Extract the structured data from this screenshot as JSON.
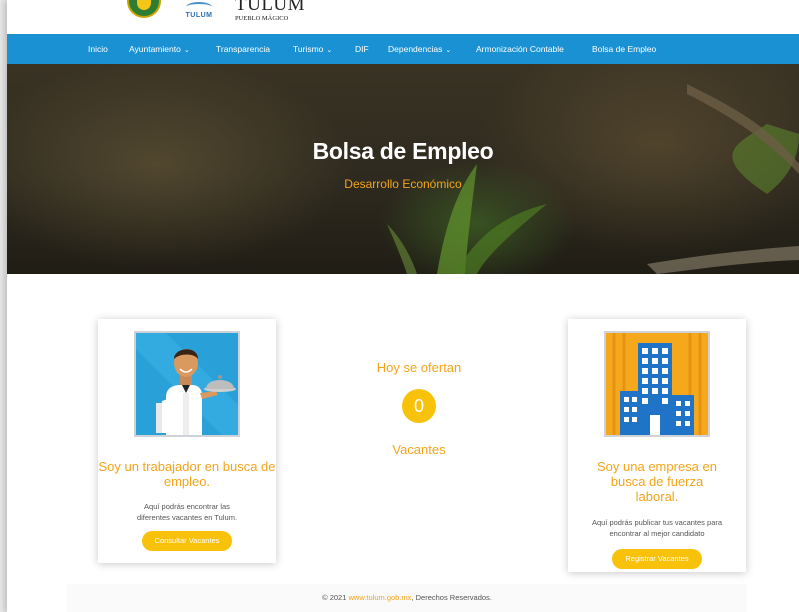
{
  "header": {
    "logo_tulum_small": "TULUM",
    "logo_pueblo_big": "TULUM",
    "logo_pueblo_small": "PUEBLO MÁGICO"
  },
  "nav": {
    "items": [
      {
        "label": "Inicio"
      },
      {
        "label": "Ayuntamiento"
      },
      {
        "label": "Transparencia"
      },
      {
        "label": "Turismo"
      },
      {
        "label": "DIF"
      },
      {
        "label": "Dependencias"
      },
      {
        "label": "Armonización Contable"
      },
      {
        "label": "Bolsa de Empleo"
      }
    ],
    "caret": "⌄"
  },
  "hero": {
    "title": "Bolsa de Empleo",
    "subtitle": "Desarrollo Económico"
  },
  "worker_card": {
    "title": "Soy un trabajador en busca de empleo.",
    "text": "Aquí podrás encontrar las diferentes vacantes en Tulum.",
    "button": "Consultar Vacantes"
  },
  "vacancies": {
    "top_label": "Hoy se ofertan",
    "count": "0",
    "bottom_label": "Vacantes"
  },
  "company_card": {
    "title": "Soy una empresa en busca de fuerza laboral.",
    "text": "Aquí podrás publicar tus vacantes para encontrar al mejor candidato",
    "button": "Registrar Vacantes"
  },
  "footer": {
    "prefix": "© 2021 ",
    "link": "www.tulum.gob.mx",
    "suffix": ", Derechos Reservados."
  },
  "colors": {
    "nav_bg": "#1a91d2",
    "accent_orange": "#f3a41b",
    "button_yellow": "#f8c20a"
  }
}
